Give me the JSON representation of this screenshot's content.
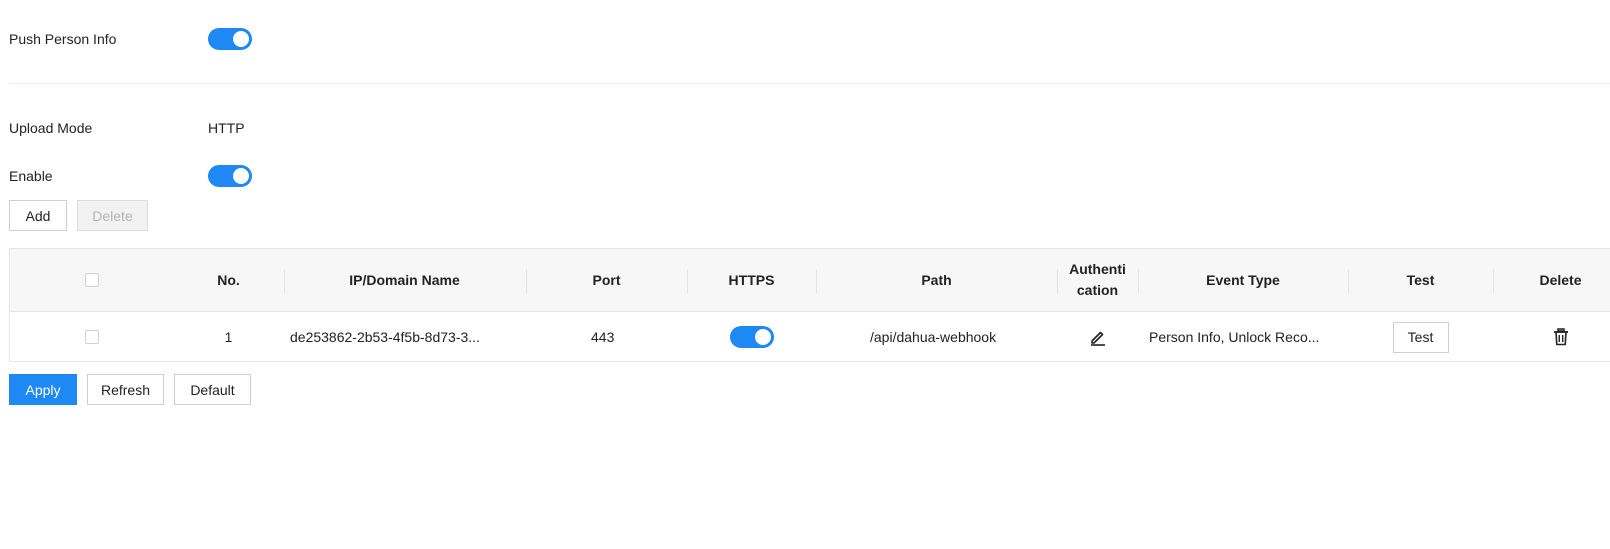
{
  "push_person_info": {
    "label": "Push Person Info",
    "enabled": true
  },
  "upload_mode": {
    "label": "Upload Mode",
    "value": "HTTP"
  },
  "enable": {
    "label": "Enable",
    "enabled": true
  },
  "toolbar": {
    "add_label": "Add",
    "delete_label": "Delete"
  },
  "table": {
    "columns": {
      "no": "No.",
      "ip": "IP/Domain Name",
      "port": "Port",
      "https": "HTTPS",
      "path": "Path",
      "auth_line1": "Authenti",
      "auth_line2": "cation",
      "event": "Event Type",
      "test": "Test",
      "delete": "Delete"
    },
    "rows": [
      {
        "no": "1",
        "ip": "de253862-2b53-4f5b-8d73-3...",
        "port": "443",
        "https": true,
        "path": "/api/dahua-webhook",
        "auth_icon": "edit-icon",
        "event": "Person Info, Unlock Reco...",
        "test_label": "Test",
        "delete_icon": "trash-icon"
      }
    ]
  },
  "footer": {
    "apply_label": "Apply",
    "refresh_label": "Refresh",
    "default_label": "Default"
  },
  "colors": {
    "accent": "#1e88f5",
    "header_bg": "#f7f7f7",
    "border": "#e6e6e6"
  }
}
